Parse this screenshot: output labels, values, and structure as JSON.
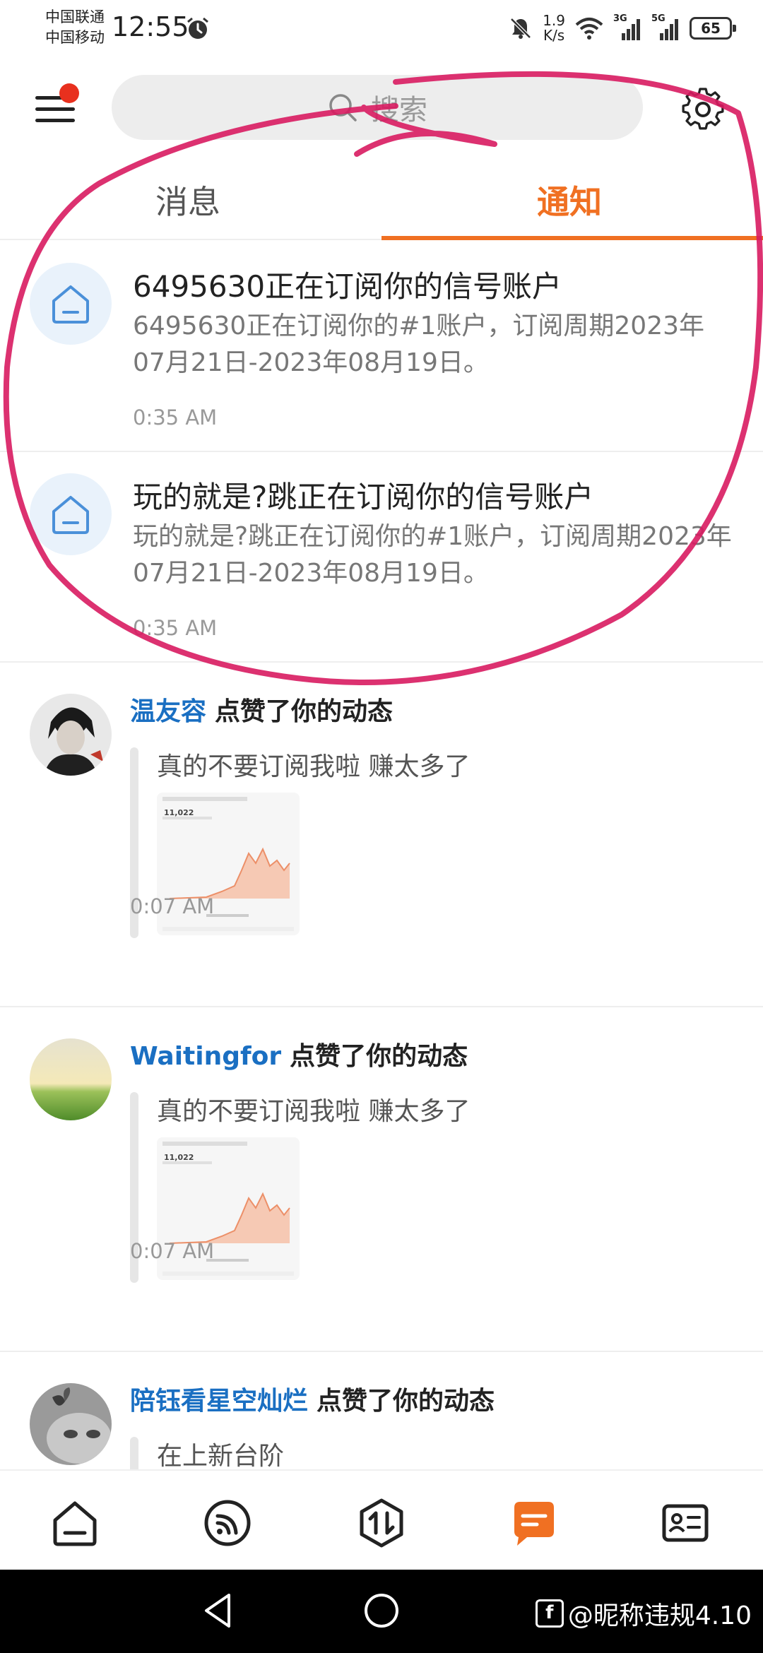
{
  "status_bar": {
    "carrier_1": "中国联通",
    "carrier_2": "中国移动",
    "time": "12:55",
    "net_speed_value": "1.9",
    "net_speed_unit": "K/s",
    "signal_1_label": "3G",
    "signal_2_label": "5G",
    "battery": "65"
  },
  "header": {
    "search_placeholder": "搜索",
    "menu_has_badge": true
  },
  "tabs": [
    {
      "label": "消息",
      "active": false
    },
    {
      "label": "通知",
      "active": true
    }
  ],
  "notifications": [
    {
      "title": "6495630正在订阅你的信号账户",
      "body": "6495630正在订阅你的#1账户，订阅周期2023年07月21日-2023年08月19日。",
      "time": "0:35 AM",
      "icon": "house-icon"
    },
    {
      "title": "玩的就是?跳正在订阅你的信号账户",
      "body": "玩的就是?跳正在订阅你的#1账户，订阅周期2023年07月21日-2023年08月19日。",
      "time": "0:35 AM",
      "icon": "house-icon"
    }
  ],
  "likes": [
    {
      "user": "温友容",
      "action": "点赞了你的动态",
      "quote": "真的不要订阅我啦 赚太多了",
      "thumb_value": "11,022",
      "time": "0:07 AM"
    },
    {
      "user": "Waitingfor",
      "action": "点赞了你的动态",
      "quote": "真的不要订阅我啦 赚太多了",
      "thumb_value": "11,022",
      "time": "0:07 AM"
    },
    {
      "user": "陪钰看星空灿烂",
      "action": "点赞了你的动态",
      "quote": "在上新台阶",
      "time": ""
    }
  ],
  "bottom_nav": [
    {
      "icon": "home-icon",
      "active": false
    },
    {
      "icon": "feed-icon",
      "active": false
    },
    {
      "icon": "trade-icon",
      "active": false
    },
    {
      "icon": "message-icon",
      "active": true
    },
    {
      "icon": "profile-card-icon",
      "active": false
    }
  ],
  "watermark": {
    "text": "@昵称违规4.10"
  },
  "colors": {
    "accent": "#f07022",
    "user_link": "#1a6fc2",
    "annotation": "#d81b60"
  }
}
